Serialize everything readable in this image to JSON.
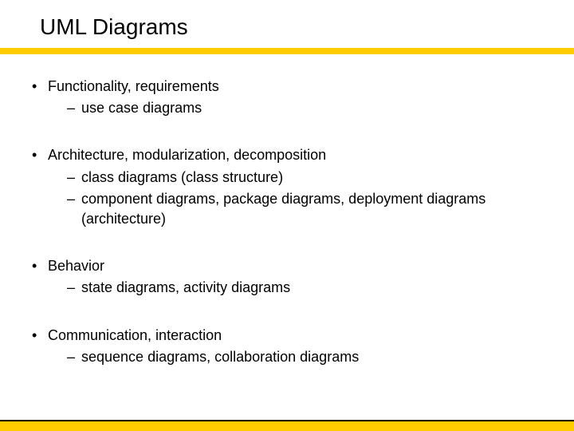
{
  "title": "UML Diagrams",
  "groups": [
    {
      "main": "Functionality, requirements",
      "subs": [
        "use case diagrams"
      ]
    },
    {
      "main": "Architecture, modularization, decomposition",
      "subs": [
        "class diagrams (class structure)",
        "component diagrams, package diagrams, deployment diagrams (architecture)"
      ]
    },
    {
      "main": "Behavior",
      "subs": [
        "state diagrams, activity diagrams"
      ]
    },
    {
      "main": "Communication, interaction",
      "subs": [
        "sequence diagrams, collaboration diagrams"
      ]
    }
  ]
}
